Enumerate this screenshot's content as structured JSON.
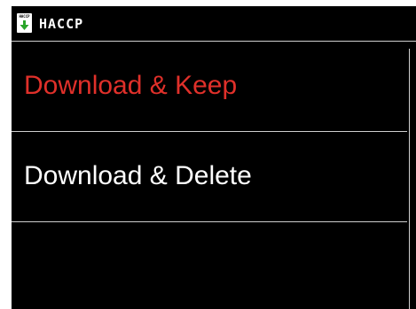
{
  "header": {
    "icon": "haccp-download-icon",
    "icon_label": "HACCP",
    "title": "HACCP"
  },
  "menu": {
    "items": [
      {
        "label": "Download & Keep",
        "selected": true
      },
      {
        "label": "Download & Delete",
        "selected": false
      },
      {
        "label": "",
        "selected": false
      }
    ]
  },
  "colors": {
    "background": "#000000",
    "text": "#ffffff",
    "selected_text": "#e0302a",
    "divider": "#cfcfcf",
    "icon_arrow": "#2aa52a"
  }
}
